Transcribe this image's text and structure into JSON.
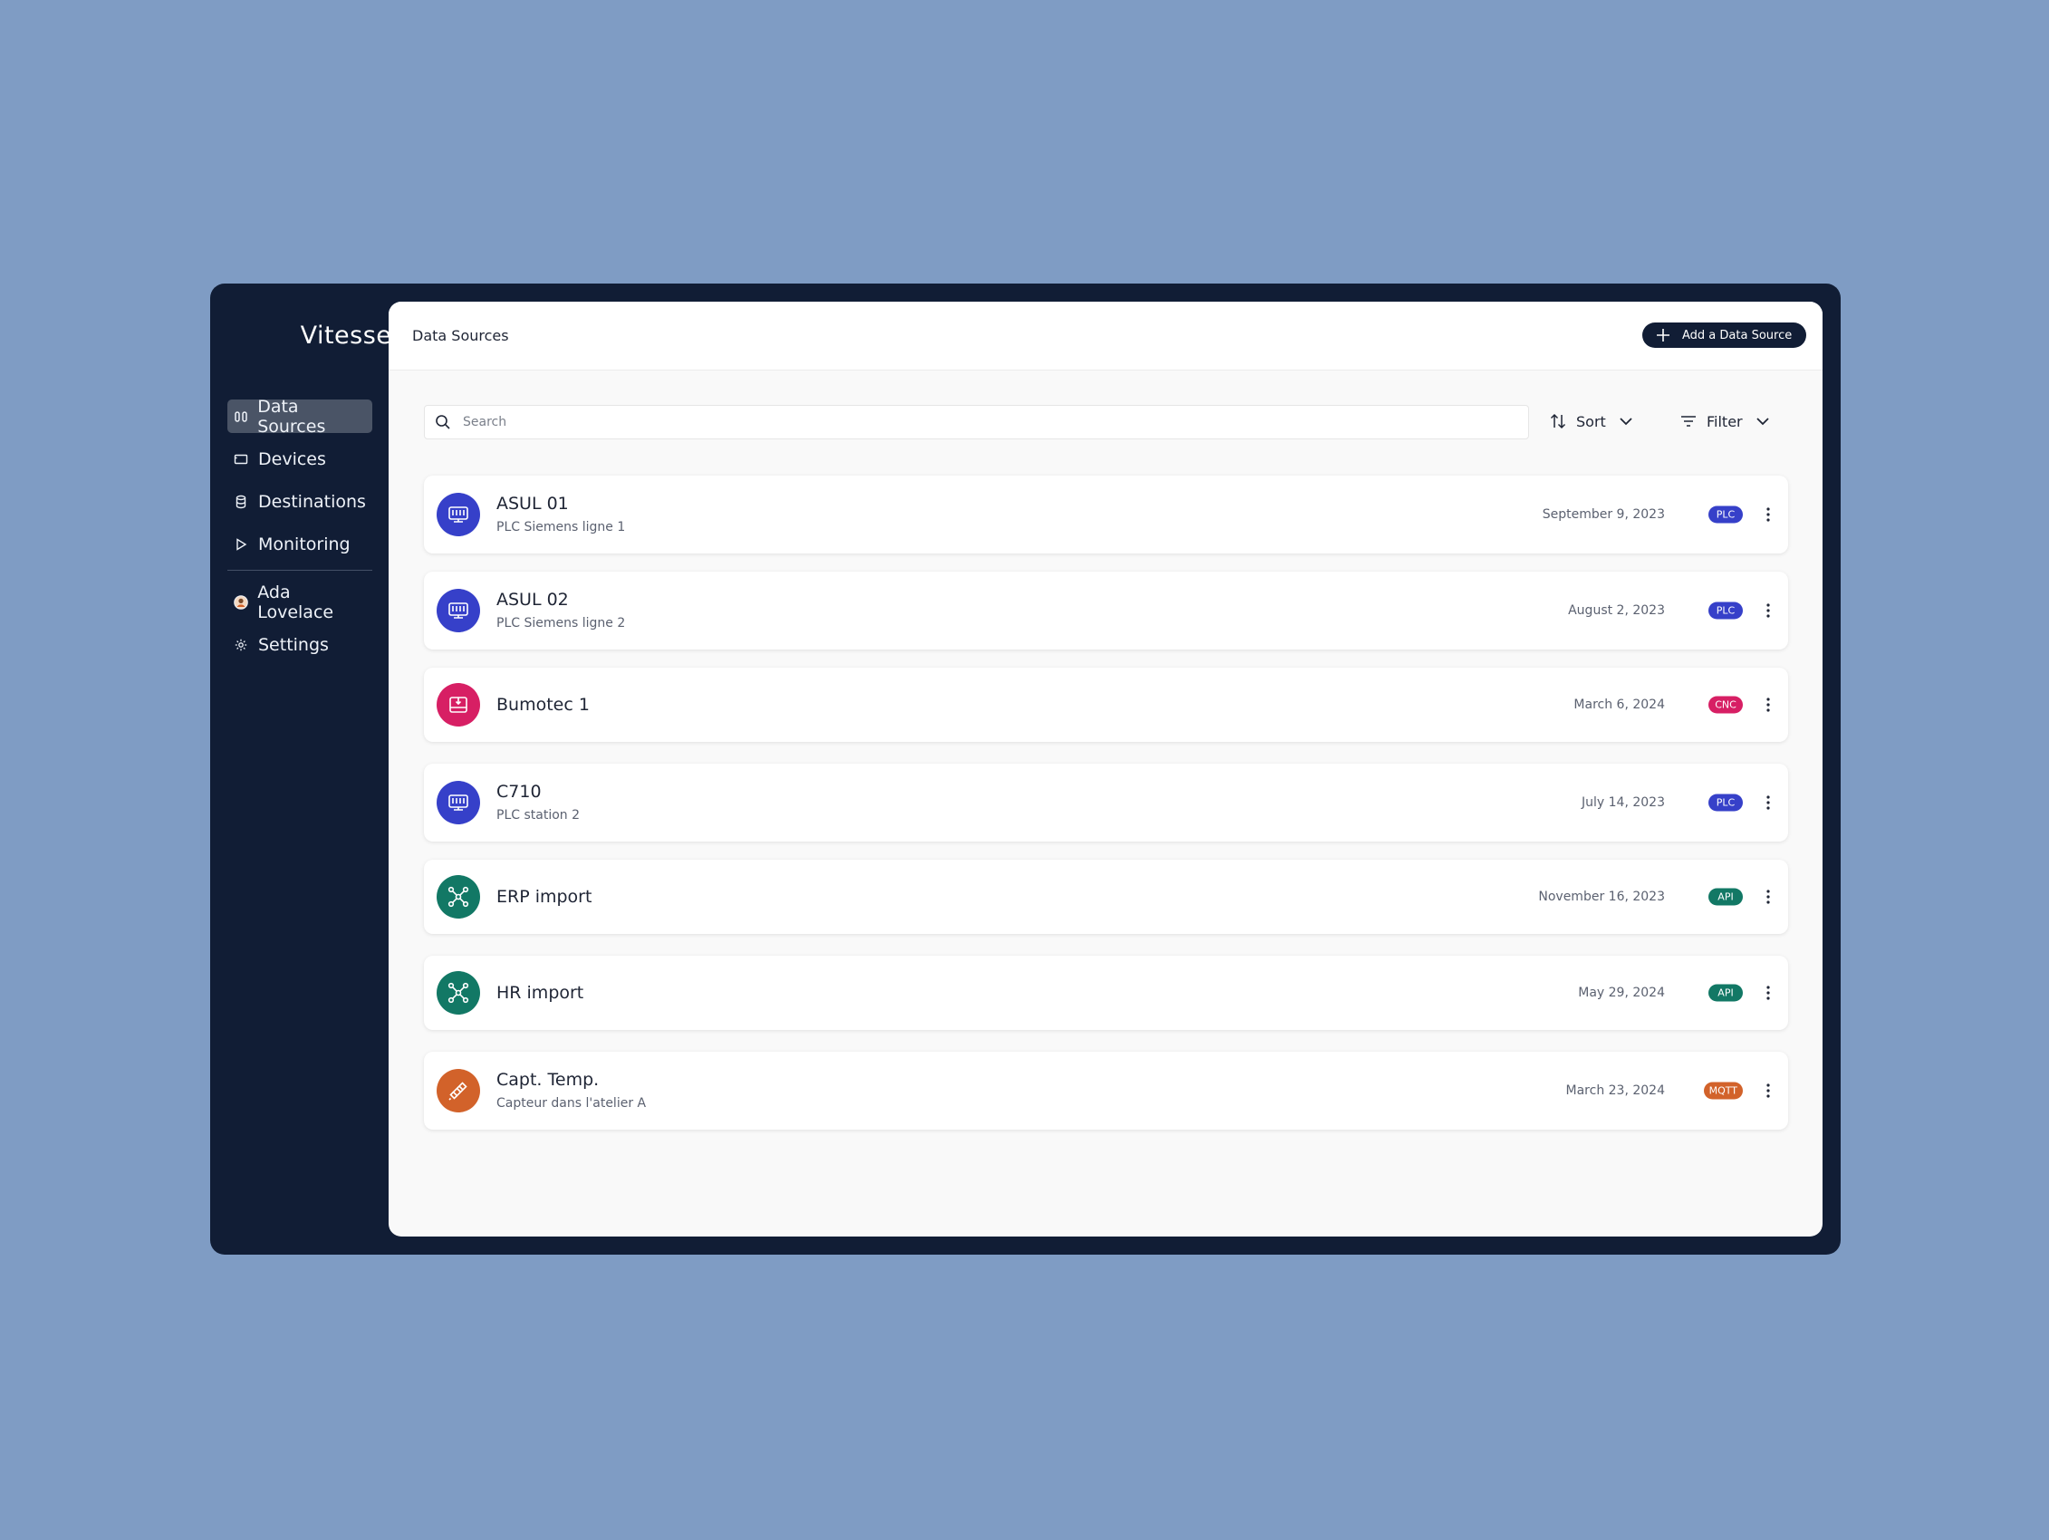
{
  "app": {
    "title": "Vitesse"
  },
  "sidebar": {
    "items": [
      {
        "label": "Data Sources",
        "icon": "data-sources-icon",
        "active": true
      },
      {
        "label": "Devices",
        "icon": "devices-icon"
      },
      {
        "label": "Destinations",
        "icon": "database-icon"
      },
      {
        "label": "Monitoring",
        "icon": "play-icon"
      },
      {
        "label": "Ada Lovelace",
        "icon": "user-avatar-icon"
      },
      {
        "label": "Settings",
        "icon": "gear-icon"
      }
    ]
  },
  "header": {
    "title": "Data Sources",
    "add_label": "Add a Data Source"
  },
  "toolbar": {
    "search_placeholder": "Search",
    "sort_label": "Sort",
    "filter_label": "Filter"
  },
  "colors": {
    "plc": "#3640c9",
    "cnc": "#d71f64",
    "api": "#127865",
    "mqtt": "#d2622a",
    "sidebar": "#111d35"
  },
  "sources": [
    {
      "name": "ASUL 01",
      "subtitle": "PLC Siemens ligne 1",
      "date": "September 9, 2023",
      "badge": "PLC",
      "icon": "plc-icon"
    },
    {
      "name": "ASUL 02",
      "subtitle": "PLC Siemens ligne 2",
      "date": "August 2, 2023",
      "badge": "PLC",
      "icon": "plc-icon"
    },
    {
      "name": "Bumotec 1",
      "subtitle": "",
      "date": "March 6, 2024",
      "badge": "CNC",
      "icon": "cnc-icon"
    },
    {
      "name": "C710",
      "subtitle": "PLC station 2",
      "date": "July 14, 2023",
      "badge": "PLC",
      "icon": "plc-icon"
    },
    {
      "name": "ERP import",
      "subtitle": "",
      "date": "November 16, 2023",
      "badge": "API",
      "icon": "network-icon"
    },
    {
      "name": "HR import",
      "subtitle": "",
      "date": "May 29, 2024",
      "badge": "API",
      "icon": "network-icon"
    },
    {
      "name": "Capt. Temp.",
      "subtitle": "Capteur dans l'atelier A",
      "date": "March 23, 2024",
      "badge": "MQTT",
      "icon": "sensor-icon"
    }
  ]
}
